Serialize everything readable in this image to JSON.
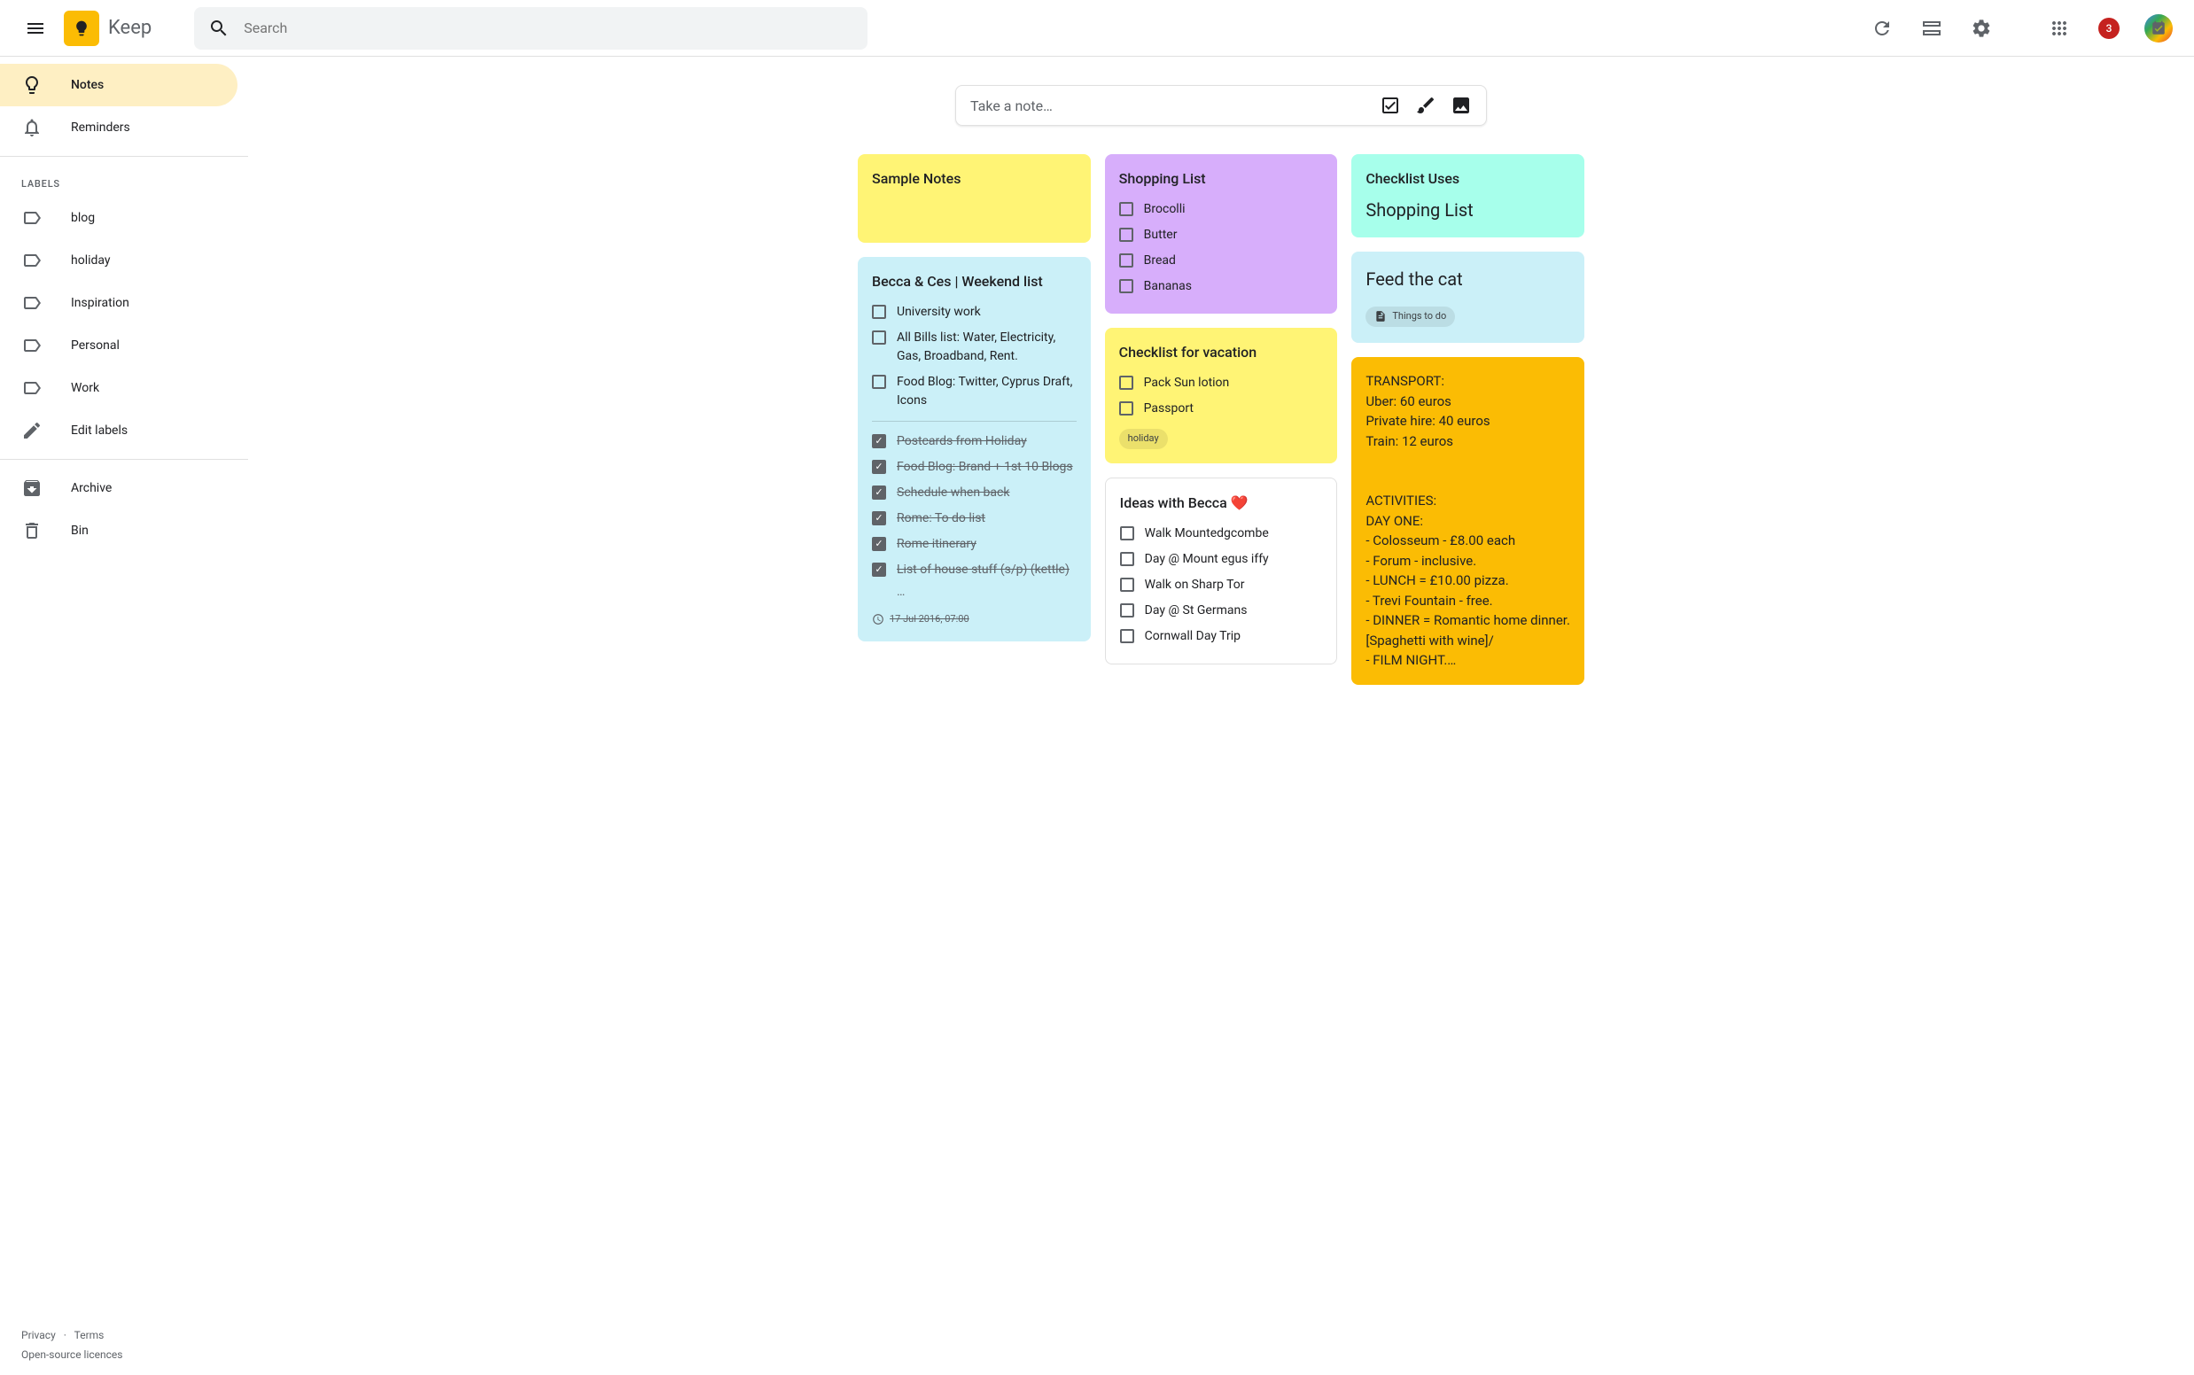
{
  "header": {
    "app_name": "Keep",
    "search_placeholder": "Search",
    "badge_count": "3"
  },
  "sidebar": {
    "items": [
      {
        "label": "Notes"
      },
      {
        "label": "Reminders"
      }
    ],
    "labels_header": "LABELS",
    "labels": [
      {
        "label": "blog"
      },
      {
        "label": "holiday"
      },
      {
        "label": "Inspiration"
      },
      {
        "label": "Personal"
      },
      {
        "label": "Work"
      }
    ],
    "edit_labels": "Edit labels",
    "archive": "Archive",
    "bin": "Bin",
    "footer": {
      "privacy": "Privacy",
      "terms": "Terms",
      "licences": "Open-source licences"
    }
  },
  "take_note": {
    "placeholder": "Take a note…"
  },
  "notes": {
    "sample": {
      "title": "Sample Notes"
    },
    "weekend": {
      "title": "Becca & Ces | Weekend list",
      "items": [
        "University work",
        "All Bills list: Water, Electricity, Gas, Broadband, Rent.",
        "Food Blog: Twitter, Cyprus Draft, Icons"
      ],
      "done": [
        "Postcards from Holiday",
        "Food Blog: Brand + 1st 10 Blogs",
        "Schedule when back",
        "Rome: To do list",
        "Rome itinerary",
        "List of house stuff (s/p) (kettle)"
      ],
      "more": "…",
      "time": "17 Jul 2016, 07:00"
    },
    "shopping": {
      "title": "Shopping List",
      "items": [
        "Brocolli",
        "Butter",
        "Bread",
        "Bananas"
      ]
    },
    "vacation": {
      "title": "Checklist for vacation",
      "items": [
        "Pack Sun lotion",
        "Passport"
      ],
      "chip": "holiday"
    },
    "ideas": {
      "title": "Ideas with Becca ❤️",
      "items": [
        "Walk Mountedgcombe",
        "Day @ Mount egus iffy",
        "Walk on Sharp Tor",
        "Day @ St Germans",
        "Cornwall Day Trip"
      ]
    },
    "checklist_uses": {
      "title": "Checklist Uses",
      "text": "Shopping List"
    },
    "feed_cat": {
      "title": "Feed the cat",
      "chip": "Things to do"
    },
    "transport": {
      "text": "TRANSPORT:\nUber: 60 euros\nPrivate hire: 40 euros\nTrain: 12 euros\n\n\nACTIVITIES:\nDAY ONE:\n- Colosseum - £8.00 each\n- Forum - inclusive.\n- LUNCH = £10.00 pizza.\n- Trevi Fountain - free.\n- DINNER = Romantic home dinner. [Spaghetti with wine]/\n- FILM NIGHT.…"
    }
  }
}
